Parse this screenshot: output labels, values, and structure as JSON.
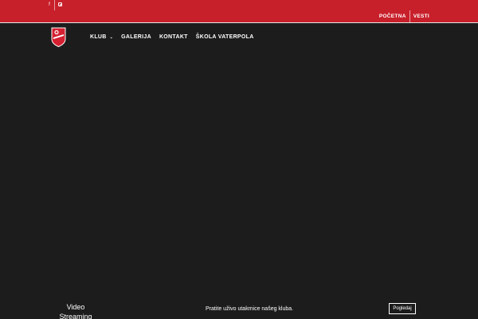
{
  "topbar": {
    "social": [
      {
        "icon": "facebook-icon",
        "glyph": "f"
      },
      {
        "icon": "instagram-icon"
      }
    ],
    "links": [
      "POČETNA",
      "VESTI"
    ],
    "color": "#c8202b"
  },
  "nav": {
    "items": [
      "KLUB",
      "GALERIJA",
      "KONTAKT",
      "ŠKOLA VATERPOLA"
    ]
  },
  "streaming": {
    "title": "Video Streaming",
    "description": "Pratite uživo utakmice našeg kluba.",
    "button": "Pogledaj"
  },
  "colors": {
    "accent": "#c8202b",
    "background": "#1c1c1c",
    "text": "#ffffff"
  }
}
